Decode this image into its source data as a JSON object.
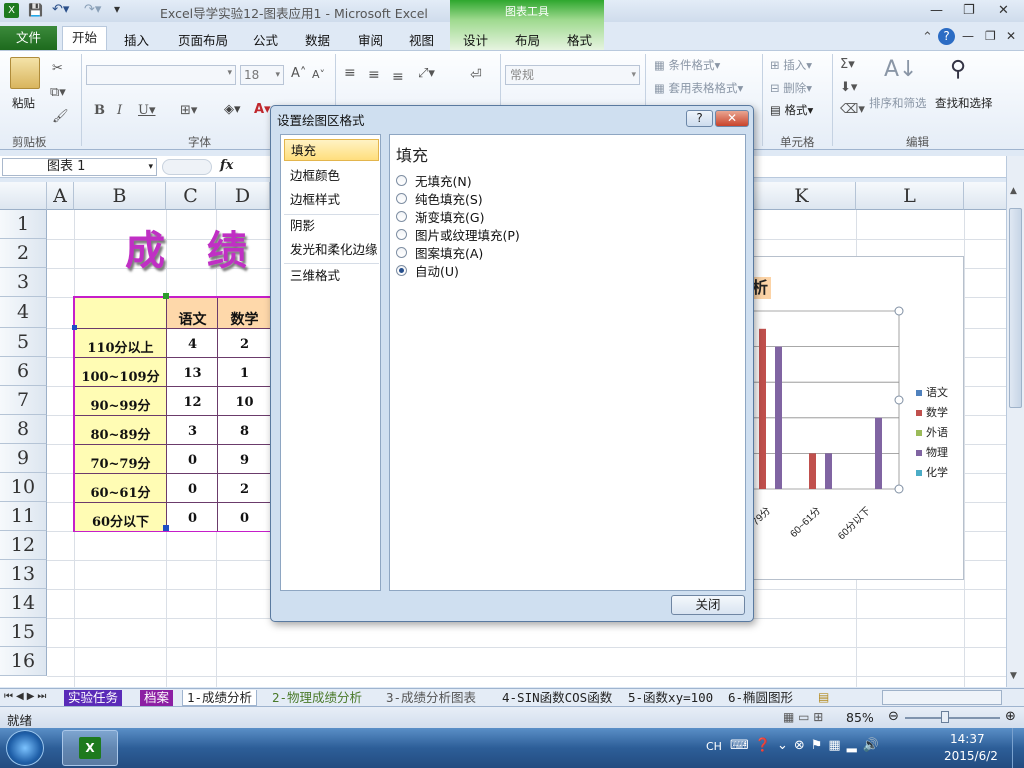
{
  "window": {
    "title": "Excel导学实验12-图表应用1  -  Microsoft Excel",
    "context_tab_group": "图表工具"
  },
  "tabs": [
    "文件",
    "开始",
    "插入",
    "页面布局",
    "公式",
    "数据",
    "审阅",
    "视图",
    "设计",
    "布局",
    "格式"
  ],
  "ribbon": {
    "paste": "粘贴",
    "font_size": "18",
    "number_format": "常规",
    "conditional_format": "条件格式",
    "table_format": "套用表格格式",
    "insert": "插入",
    "delete": "删除",
    "format": "格式",
    "sort_filter": "排序和筛选",
    "find_select": "查找和选择",
    "groups": [
      "剪贴板",
      "字体",
      "单元格",
      "编辑"
    ]
  },
  "formula_bar": {
    "name_box": "图表 1",
    "fx": "fx"
  },
  "columns": [
    "A",
    "B",
    "C",
    "D",
    "K",
    "L"
  ],
  "rows": [
    "1",
    "2",
    "3",
    "4",
    "5",
    "6",
    "7",
    "8",
    "9",
    "10",
    "11",
    "12",
    "13",
    "14",
    "15",
    "16"
  ],
  "sheet": {
    "title_art": "成 绩 分",
    "table_headers": [
      "语文",
      "数学"
    ],
    "table_rows": [
      {
        "label": "110分以上",
        "c": "4",
        "d": "2"
      },
      {
        "label": "100~109分",
        "c": "13",
        "d": "1"
      },
      {
        "label": "90~99分",
        "c": "12",
        "d": "10"
      },
      {
        "label": "80~89分",
        "c": "3",
        "d": "8"
      },
      {
        "label": "70~79分",
        "c": "0",
        "d": "9"
      },
      {
        "label": "60~61分",
        "c": "0",
        "d": "2"
      },
      {
        "label": "60分以下",
        "c": "0",
        "d": "0"
      }
    ]
  },
  "chart_data": {
    "type": "bar",
    "title": "析",
    "categories": [
      "79分",
      "60~61分",
      "60分以下"
    ],
    "series": [
      {
        "name": "语文",
        "color": "#4f81bd",
        "values": [
          0,
          0,
          0
        ]
      },
      {
        "name": "数学",
        "color": "#c0504d",
        "values": [
          9,
          2,
          0
        ]
      },
      {
        "name": "外语",
        "color": "#9bbb59",
        "values": [
          0,
          0,
          0
        ]
      },
      {
        "name": "物理",
        "color": "#8064a2",
        "values": [
          8,
          2,
          4
        ]
      },
      {
        "name": "化学",
        "color": "#4bacc6",
        "values": [
          0,
          0,
          0
        ]
      }
    ]
  },
  "dialog": {
    "title": "设置绘图区格式",
    "help": "?",
    "close_x": "✕",
    "nav": [
      "填充",
      "边框颜色",
      "边框样式",
      "阴影",
      "发光和柔化边缘",
      "三维格式"
    ],
    "section_title": "填充",
    "options": [
      "无填充(N)",
      "纯色填充(S)",
      "渐变填充(G)",
      "图片或纹理填充(P)",
      "图案填充(A)",
      "自动(U)"
    ],
    "selected_option": "自动(U)",
    "close_button": "关闭"
  },
  "sheet_tabs": [
    "实验任务",
    "档案",
    "1-成绩分析",
    "2-物理成绩分析",
    "3-成绩分析图表",
    "4-SIN函数COS函数",
    "5-函数xy=100",
    "6-椭圆图形"
  ],
  "status": {
    "ready": "就绪",
    "zoom": "85%"
  },
  "taskbar": {
    "lang": "CH",
    "time": "14:37",
    "date": "2015/6/2"
  }
}
